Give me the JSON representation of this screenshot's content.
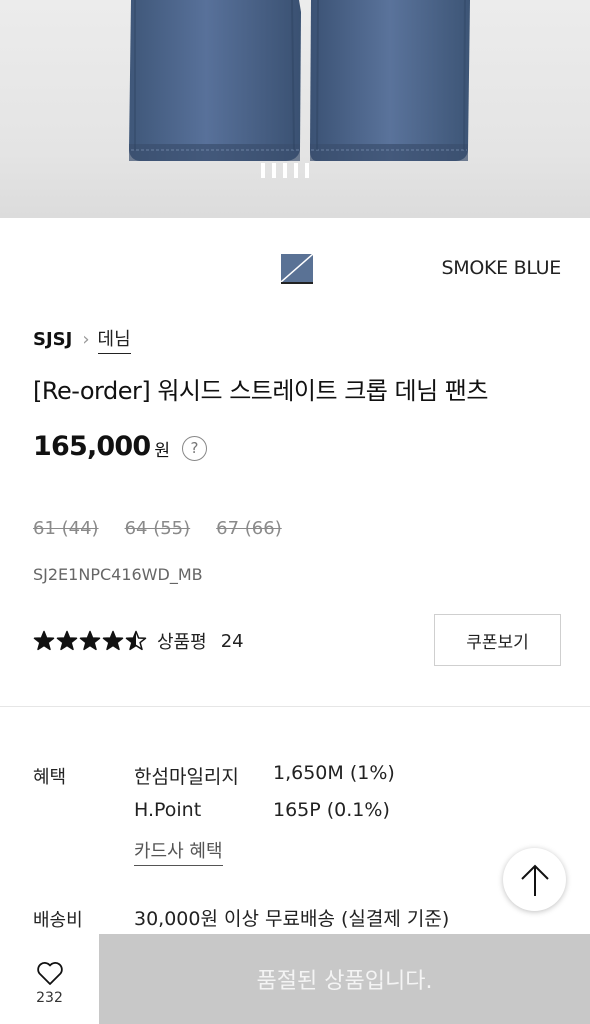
{
  "product": {
    "color_name": "SMOKE BLUE",
    "brand": "SJSJ",
    "category": "데님",
    "title": "[Re-order] 워시드 스트레이트 크롭 데님 팬츠",
    "price": "165,000",
    "price_unit": "원",
    "help_symbol": "?",
    "sizes": [
      "61 (44)",
      "64 (55)",
      "67 (66)"
    ],
    "code": "SJ2E1NPC416WD_MB"
  },
  "rating": {
    "stars": 4.5,
    "review_label": "상품평",
    "review_count": "24"
  },
  "coupon": {
    "label": "쿠폰보기"
  },
  "benefits": {
    "label": "혜택",
    "items": [
      {
        "name": "한섬마일리지",
        "value": "1,650M (1%)"
      },
      {
        "name": "H.Point",
        "value": "165P (0.1%)"
      }
    ],
    "card_link": "카드사 혜택"
  },
  "shipping": {
    "label": "배송비",
    "text": "30,000원 이상 무료배송 (실결제 기준)"
  },
  "bottom_bar": {
    "wish_count": "232",
    "soldout_label": "품절된 상품입니다."
  },
  "icons": {
    "scroll_top": "arrow-up-icon",
    "wish": "heart-icon",
    "star": "star-icon"
  },
  "carousel": {
    "slide_count": 5
  },
  "colors": {
    "denim": "#4f6789",
    "soldout_bg": "#c8c8c8"
  }
}
